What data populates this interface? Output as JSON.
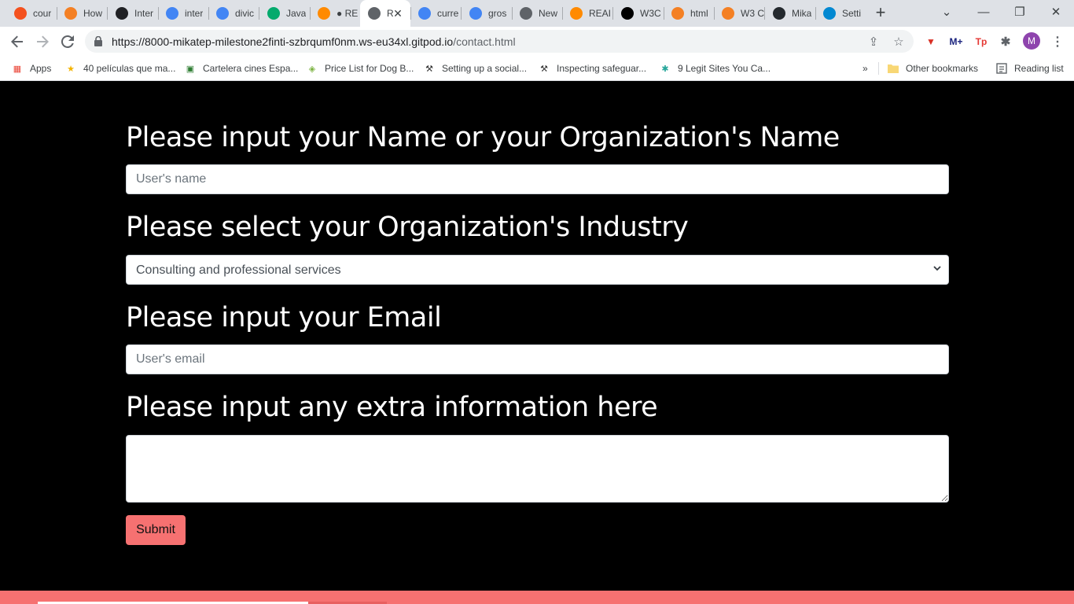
{
  "browser": {
    "tabs": [
      {
        "label": "cour",
        "icon": "circle-icon",
        "color": "#f4511e"
      },
      {
        "label": "How",
        "icon": "stackoverflow-icon",
        "color": "#f48024"
      },
      {
        "label": "Inter",
        "icon": "globe-icon",
        "color": "#202124"
      },
      {
        "label": "inter",
        "icon": "google-icon",
        "color": "#4285f4"
      },
      {
        "label": "divic",
        "icon": "google-icon",
        "color": "#4285f4"
      },
      {
        "label": "Java",
        "icon": "w3-icon",
        "color": "#04aa6d"
      },
      {
        "label": "● RE",
        "icon": "gitpod-icon",
        "color": "#ff8a00"
      },
      {
        "label": "R",
        "icon": "globe-icon",
        "color": "#5f6368"
      },
      {
        "label": "curre",
        "icon": "google-icon",
        "color": "#4285f4"
      },
      {
        "label": "gros",
        "icon": "google-icon",
        "color": "#4285f4"
      },
      {
        "label": "New",
        "icon": "chrome-icon",
        "color": "#5f6368"
      },
      {
        "label": "REAI",
        "icon": "gitpod-icon",
        "color": "#ff8a00"
      },
      {
        "label": "W3C",
        "icon": "w3c-icon",
        "color": "#000000"
      },
      {
        "label": "html",
        "icon": "stackoverflow-icon",
        "color": "#f48024"
      },
      {
        "label": "W3 C",
        "icon": "stackoverflow-icon",
        "color": "#f48024"
      },
      {
        "label": "Mika",
        "icon": "github-icon",
        "color": "#24292e"
      },
      {
        "label": "Setti",
        "icon": "diamond-icon",
        "color": "#0288d1"
      }
    ],
    "active_tab_index": 7,
    "url_host": "https://8000-mikatep-milestone2finti-szbrqumf0nm.ws-eu34xl.gitpod.io",
    "url_path": "/contact.html",
    "avatar_letter": "M",
    "extensions": [
      {
        "name": "shield-ext-icon",
        "glyph": "▼",
        "color": "#d93025"
      },
      {
        "name": "m-plus-ext-icon",
        "glyph": "M+",
        "color": "#1a237e"
      },
      {
        "name": "tp-ext-icon",
        "glyph": "Tp",
        "color": "#e53935"
      }
    ],
    "bookmarks": [
      {
        "label": "Apps",
        "icon": "apps-grid-icon"
      },
      {
        "label": "40 películas que ma...",
        "icon": "star-icon"
      },
      {
        "label": "Cartelera cines Espa...",
        "icon": "movie-icon"
      },
      {
        "label": "Price List for Dog B...",
        "icon": "tag-icon"
      },
      {
        "label": "Setting up a social...",
        "icon": "tool-icon"
      },
      {
        "label": "Inspecting safeguar...",
        "icon": "tool-icon"
      },
      {
        "label": "9 Legit Sites You Ca...",
        "icon": "snowflake-icon"
      }
    ],
    "bookmarks_overflow": "»",
    "other_bookmarks": "Other bookmarks",
    "reading_list": "Reading list"
  },
  "form": {
    "name_heading": "Please input your Name or your Organization's Name",
    "name_placeholder": "User's name",
    "industry_heading": "Please select your Organization's Industry",
    "industry_selected": "Consulting and professional services",
    "email_heading": "Please input your Email",
    "email_placeholder": "User's email",
    "extra_heading": "Please input any extra information here",
    "extra_value": "",
    "submit_label": "Submit"
  },
  "colors": {
    "accent": "#f67171",
    "page_bg": "#000000"
  }
}
